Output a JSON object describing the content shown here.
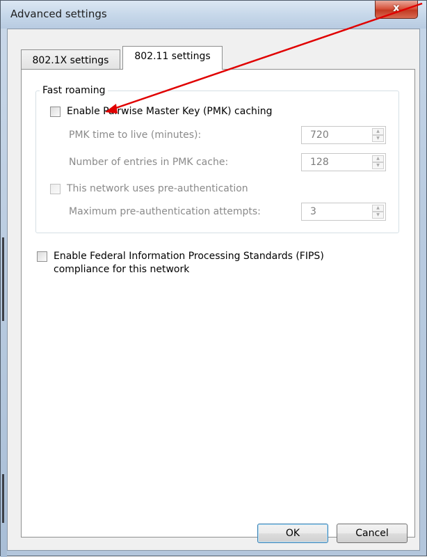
{
  "window": {
    "title": "Advanced settings",
    "close_symbol": "x"
  },
  "tabs": [
    {
      "label": "802.1X settings",
      "active": false
    },
    {
      "label": "802.11 settings",
      "active": true
    }
  ],
  "fast_roaming": {
    "group_title": "Fast roaming",
    "pmk_caching_label": "Enable Pairwise Master Key (PMK) caching",
    "pmk_ttl_label": "PMK time to live (minutes):",
    "pmk_ttl_value": "720",
    "pmk_entries_label": "Number of entries in PMK cache:",
    "pmk_entries_value": "128",
    "preauth_label": "This network uses pre-authentication",
    "preauth_attempts_label": "Maximum pre-authentication attempts:",
    "preauth_attempts_value": "3"
  },
  "fips": {
    "line1": "Enable Federal Information Processing Standards (FIPS)",
    "line2": "compliance for this network"
  },
  "buttons": {
    "ok": "OK",
    "cancel": "Cancel"
  },
  "colors": {
    "annotation_arrow": "#e00000",
    "close_button": "#c23a22"
  }
}
